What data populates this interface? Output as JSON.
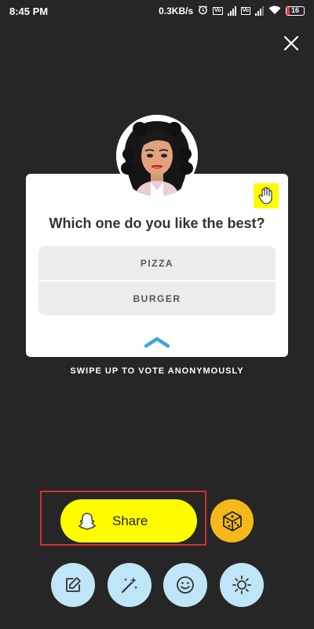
{
  "status": {
    "time": "8:45 PM",
    "speed": "0.3KB/s",
    "battery": "16",
    "battery_level": 0.16,
    "icons": [
      "alarm-icon",
      "signal-icon",
      "signal-icon",
      "wifi-icon",
      "battery-icon"
    ]
  },
  "poll": {
    "question": "Which one do you like the best?",
    "options": [
      "PIZZA",
      "BURGER"
    ],
    "hint": "SWIPE UP TO VOTE ANONYMOUSLY"
  },
  "actions": {
    "share_label": "Share"
  },
  "tools": [
    "edit-icon",
    "magic-wand-icon",
    "smiley-icon",
    "brightness-icon"
  ],
  "colors": {
    "background": "#262626",
    "snap_yellow": "#fffc00",
    "dice_orange": "#f6b81a",
    "tool_blue": "#bfe6f6",
    "chevron_blue": "#3aa7d9",
    "highlight_red": "#d32f2f"
  }
}
